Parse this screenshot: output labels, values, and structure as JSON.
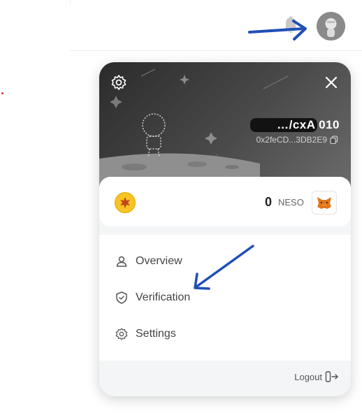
{
  "header": {
    "notification_icon": "bell-icon",
    "avatar_icon": "avatar-icon"
  },
  "panel": {
    "settings_icon": "gear-icon",
    "close_icon": "close-icon",
    "username": "…/cxA 010",
    "address": "0x2feCD...3DB2E9",
    "copy_icon": "copy-icon",
    "balance": {
      "amount": "0",
      "unit": "NESO",
      "token_icon": "neso-token-icon",
      "wallet_icon": "metamask-fox-icon"
    },
    "menu": [
      {
        "label": "Overview",
        "icon": "user-icon"
      },
      {
        "label": "Verification",
        "icon": "shield-icon"
      },
      {
        "label": "Settings",
        "icon": "gear-icon"
      }
    ],
    "logout_label": "Logout",
    "logout_icon": "logout-icon"
  },
  "colors": {
    "arrow": "#1f4fb5",
    "panel_bg": "#f4f5f7",
    "hero_dark": "#2b2b2b",
    "token_gold": "#f7c325"
  }
}
